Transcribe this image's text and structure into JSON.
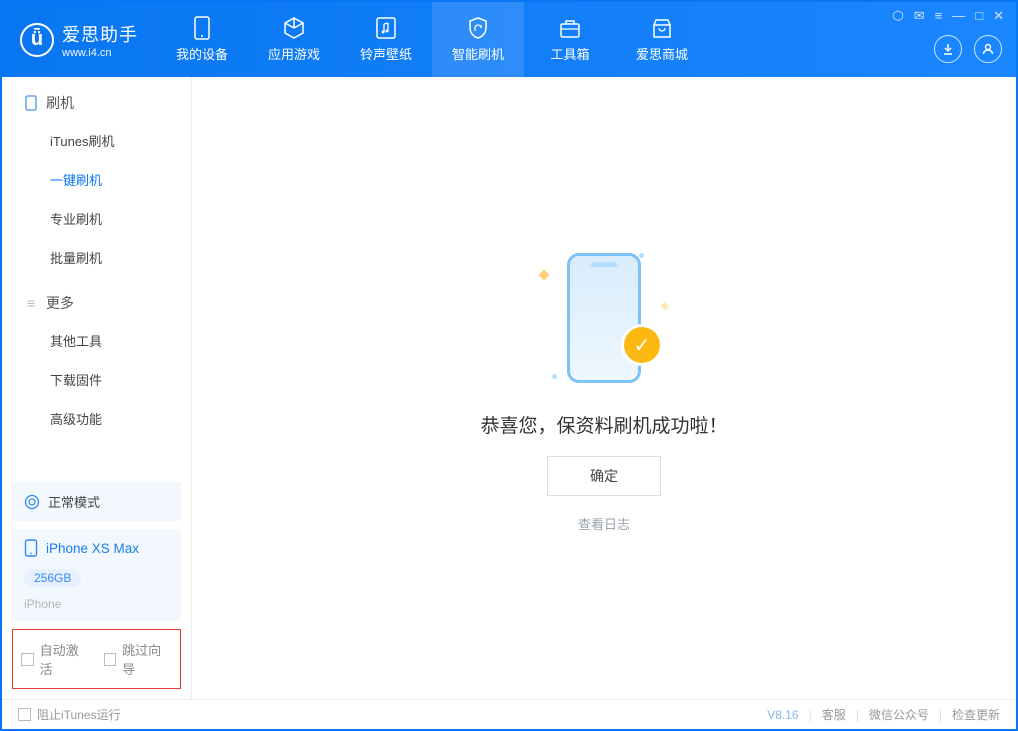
{
  "brand": {
    "name": "爱思助手",
    "url": "www.i4.cn"
  },
  "tabs": [
    {
      "label": "我的设备"
    },
    {
      "label": "应用游戏"
    },
    {
      "label": "铃声壁纸"
    },
    {
      "label": "智能刷机"
    },
    {
      "label": "工具箱"
    },
    {
      "label": "爱思商城"
    }
  ],
  "sidebar": {
    "section1_title": "刷机",
    "items1": [
      {
        "label": "iTunes刷机"
      },
      {
        "label": "一键刷机"
      },
      {
        "label": "专业刷机"
      },
      {
        "label": "批量刷机"
      }
    ],
    "section2_title": "更多",
    "items2": [
      {
        "label": "其他工具"
      },
      {
        "label": "下载固件"
      },
      {
        "label": "高级功能"
      }
    ]
  },
  "status": {
    "mode": "正常模式"
  },
  "device": {
    "name": "iPhone XS Max",
    "storage": "256GB",
    "type": "iPhone"
  },
  "options": {
    "auto_activate": "自动激活",
    "skip_guide": "跳过向导"
  },
  "main": {
    "success_text": "恭喜您，保资料刷机成功啦！",
    "ok_button": "确定",
    "view_log": "查看日志"
  },
  "footer": {
    "block_itunes": "阻止iTunes运行",
    "version": "V8.16",
    "links": [
      "客服",
      "微信公众号",
      "检查更新"
    ]
  }
}
